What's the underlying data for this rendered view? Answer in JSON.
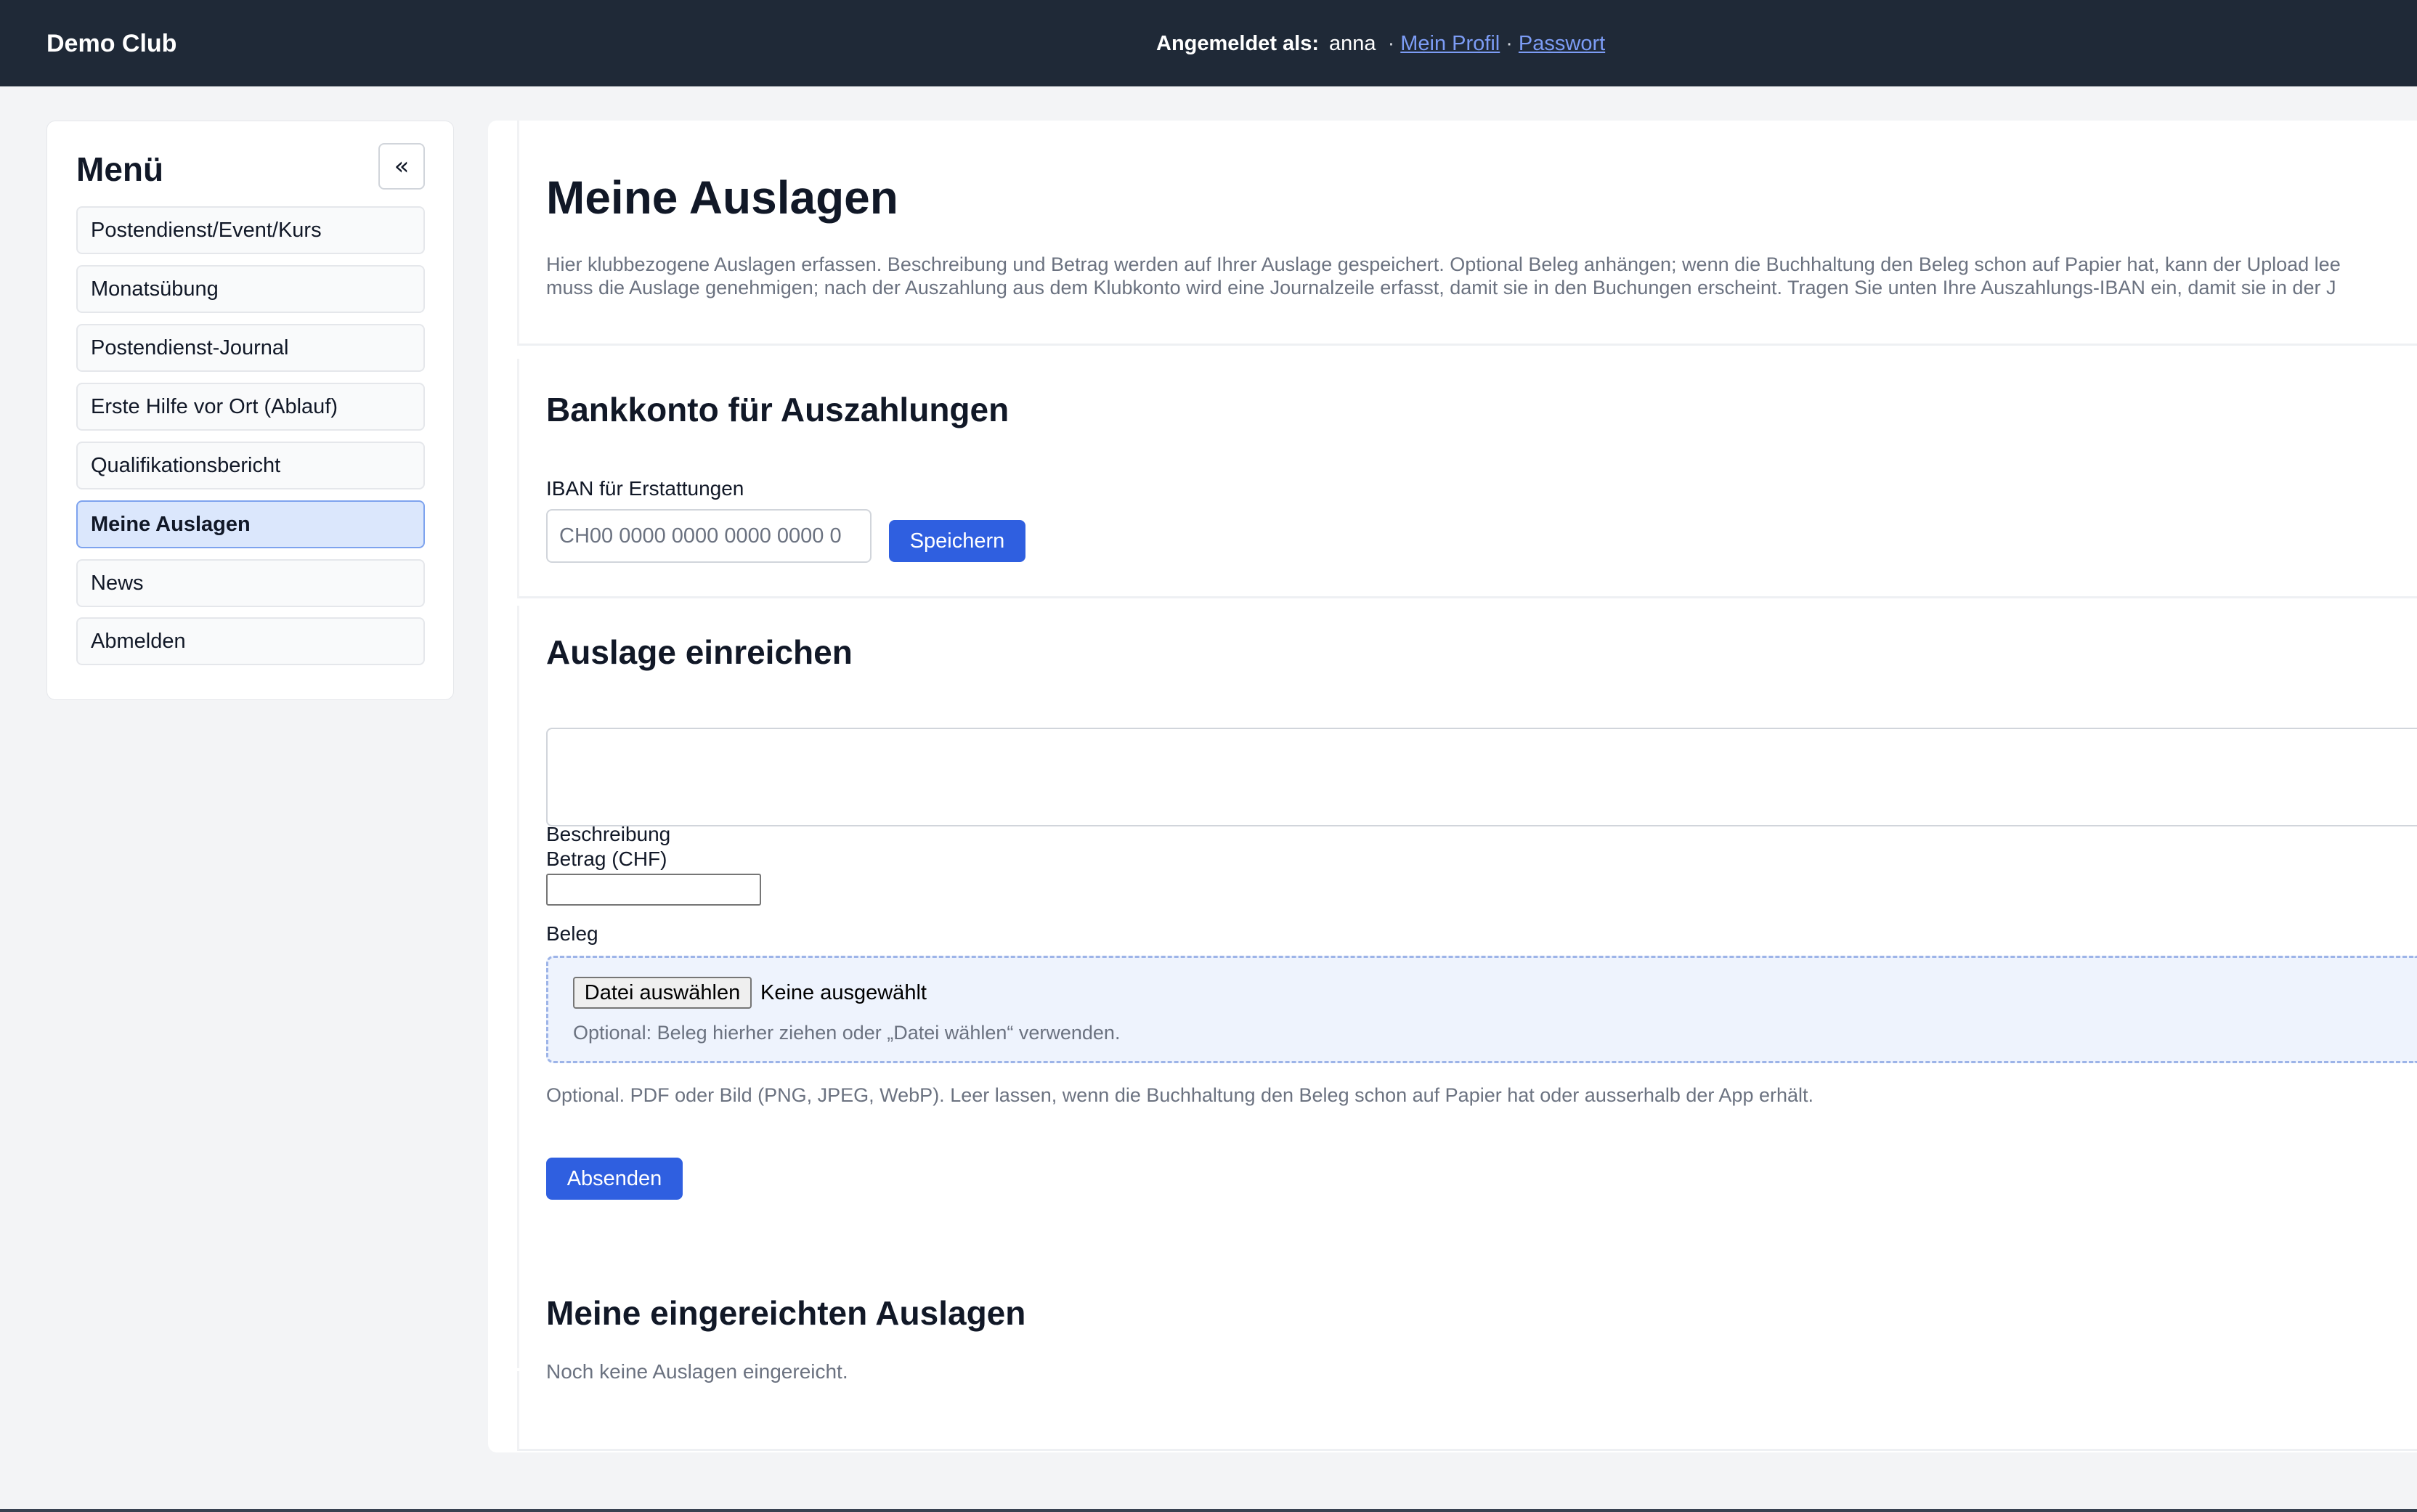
{
  "header": {
    "brand": "Demo Club",
    "logged_in_label": "Angemeldet als:",
    "username": "anna",
    "separator": "·",
    "profile_link": "Mein Profil",
    "password_link": "Passwort"
  },
  "sidebar": {
    "title": "Menü",
    "collapse_label": "«",
    "items": [
      {
        "label": "Postendienst/Event/Kurs",
        "active": false
      },
      {
        "label": "Monatsübung",
        "active": false
      },
      {
        "label": "Postendienst-Journal",
        "active": false
      },
      {
        "label": "Erste Hilfe vor Ort (Ablauf)",
        "active": false
      },
      {
        "label": "Qualifikationsbericht",
        "active": false
      },
      {
        "label": "Meine Auslagen",
        "active": true
      },
      {
        "label": "News",
        "active": false
      },
      {
        "label": "Abmelden",
        "active": false
      }
    ]
  },
  "page": {
    "title": "Meine Auslagen",
    "intro_line1": "Hier klubbezogene Auslagen erfassen. Beschreibung und Betrag werden auf Ihrer Auslage gespeichert. Optional Beleg anhängen; wenn die Buchhaltung den Beleg schon auf Papier hat, kann der Upload lee",
    "intro_line2": "muss die Auslage genehmigen; nach der Auszahlung aus dem Klubkonto wird eine Journalzeile erfasst, damit sie in den Buchungen erscheint. Tragen Sie unten Ihre Auszahlungs-IBAN ein, damit sie in der J"
  },
  "bank": {
    "heading": "Bankkonto für Auszahlungen",
    "iban_label": "IBAN für Erstattungen",
    "iban_placeholder": "CH00 0000 0000 0000 0000 0",
    "iban_value": "",
    "save_label": "Speichern"
  },
  "expense_form": {
    "heading": "Auslage einreichen",
    "description_label": "Beschreibung",
    "description_value": "",
    "amount_label": "Betrag (CHF)",
    "amount_value": "",
    "receipt_label": "Beleg",
    "file_button_label": "Datei auswählen",
    "file_status": "Keine ausgewählt",
    "drop_hint": "Optional: Beleg hierher ziehen oder „Datei wählen“ verwenden.",
    "help_text": "Optional. PDF oder Bild (PNG, JPEG, WebP). Leer lassen, wenn die Buchhaltung den Beleg schon auf Papier hat oder ausserhalb der App erhält.",
    "submit_label": "Absenden"
  },
  "submitted": {
    "heading": "Meine eingereichten Auslagen",
    "empty_text": "Noch keine Auslagen eingereicht."
  },
  "colors": {
    "topbar": "#1f2937",
    "primary_button": "#2f5fe0",
    "active_menu_bg": "#dbe7fc",
    "link": "#7c9cf5",
    "page_bg": "#f3f4f6"
  }
}
